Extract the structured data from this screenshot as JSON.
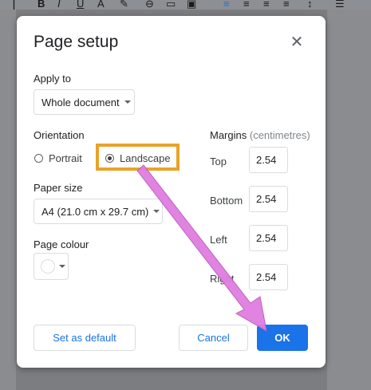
{
  "toolbar": {
    "icons": [
      "bold-icon",
      "italic-icon",
      "underline-icon",
      "text-color-icon",
      "highlight-icon",
      "link-icon",
      "comment-icon",
      "image-icon",
      "align-left-icon",
      "align-center-icon",
      "align-right-icon",
      "justify-icon",
      "numbered-list-icon"
    ]
  },
  "dialog": {
    "title": "Page setup",
    "close_icon": "close-icon",
    "apply_to": {
      "label": "Apply to",
      "value": "Whole document"
    },
    "orientation": {
      "label": "Orientation",
      "options": [
        {
          "label": "Portrait",
          "checked": false
        },
        {
          "label": "Landscape",
          "checked": true
        }
      ]
    },
    "paper_size": {
      "label": "Paper size",
      "value": "A4 (21.0 cm x 29.7 cm)"
    },
    "page_colour": {
      "label": "Page colour",
      "value": "#ffffff"
    },
    "margins": {
      "label": "Margins",
      "unit": "(centimetres)",
      "fields": [
        {
          "label": "Top",
          "value": "2.54"
        },
        {
          "label": "Bottom",
          "value": "2.54"
        },
        {
          "label": "Left",
          "value": "2.54"
        },
        {
          "label": "Right",
          "value": "2.54"
        }
      ]
    },
    "buttons": {
      "set_default": "Set as default",
      "cancel": "Cancel",
      "ok": "OK"
    }
  },
  "annotation": {
    "highlight_color": "#e8a32b",
    "arrow_color": "#e07ee0"
  }
}
